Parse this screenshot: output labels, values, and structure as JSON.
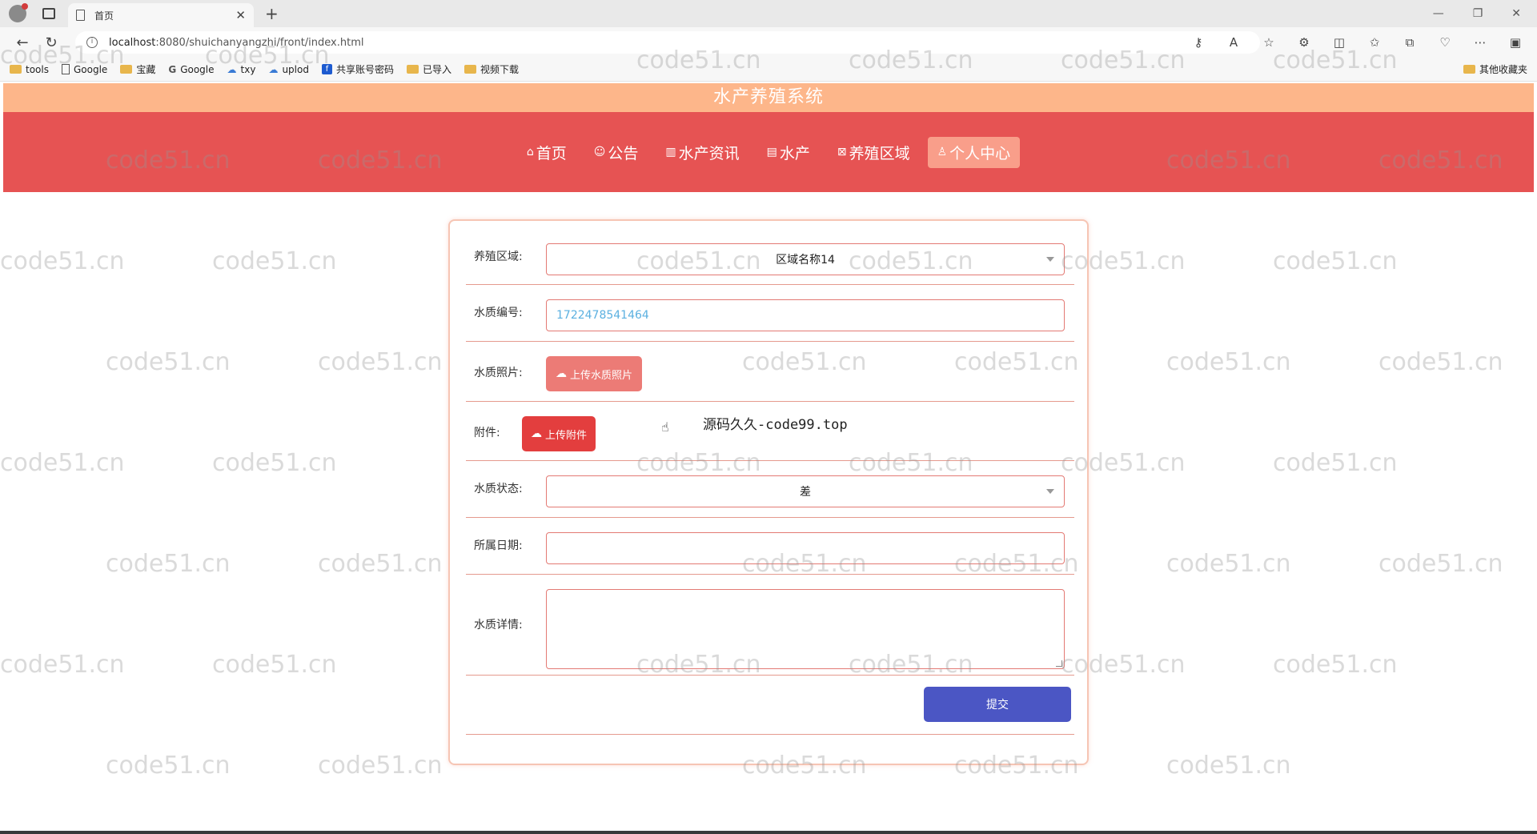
{
  "browser": {
    "tab_title": "首页",
    "url_host": "localhost",
    "url_rest": ":8080/shuichanyangzhi/front/index.html",
    "bookmarks": [
      {
        "label": "tools",
        "icon": "folder-icon"
      },
      {
        "label": "Google",
        "icon": "page-icon"
      },
      {
        "label": "宝藏",
        "icon": "folder-icon"
      },
      {
        "label": "Google",
        "icon": "google-icon"
      },
      {
        "label": "txy",
        "icon": "cloud-icon"
      },
      {
        "label": "uplod",
        "icon": "cloud-icon"
      },
      {
        "label": "共享账号密码",
        "icon": "facebook-icon"
      },
      {
        "label": "已导入",
        "icon": "folder-icon"
      },
      {
        "label": "视频下载",
        "icon": "folder-icon"
      }
    ],
    "other_bookmarks": "其他收藏夹"
  },
  "site": {
    "title": "水产养殖系统",
    "nav": [
      {
        "label": "首页",
        "icon": "home-icon"
      },
      {
        "label": "公告",
        "icon": "notice-icon"
      },
      {
        "label": "水产资讯",
        "icon": "news-icon"
      },
      {
        "label": "水产",
        "icon": "fish-icon"
      },
      {
        "label": "养殖区域",
        "icon": "area-icon"
      },
      {
        "label": "个人中心",
        "icon": "user-icon"
      }
    ],
    "active_nav": "个人中心"
  },
  "watermark": "code51.cn",
  "form": {
    "area_label": "养殖区域:",
    "area_value": "区域名称14",
    "code_label": "水质编号:",
    "code_value": "1722478541464",
    "photo_label": "水质照片:",
    "photo_button": "上传水质照片",
    "attach_label": "附件:",
    "attach_button": "上传附件",
    "attach_text": "源码久久-code99.top",
    "status_label": "水质状态:",
    "status_value": "差",
    "date_label": "所属日期:",
    "date_value": "",
    "detail_label": "水质详情:",
    "detail_value": "",
    "submit_label": "提交"
  },
  "colors": {
    "title_bar": "#fdb68a",
    "nav_bar": "#e65353",
    "nav_active": "#f99e8a",
    "field_border": "#e37a74",
    "photo_button": "#ec7b76",
    "attach_button": "#e33e3e",
    "submit_button": "#4b56c4"
  }
}
